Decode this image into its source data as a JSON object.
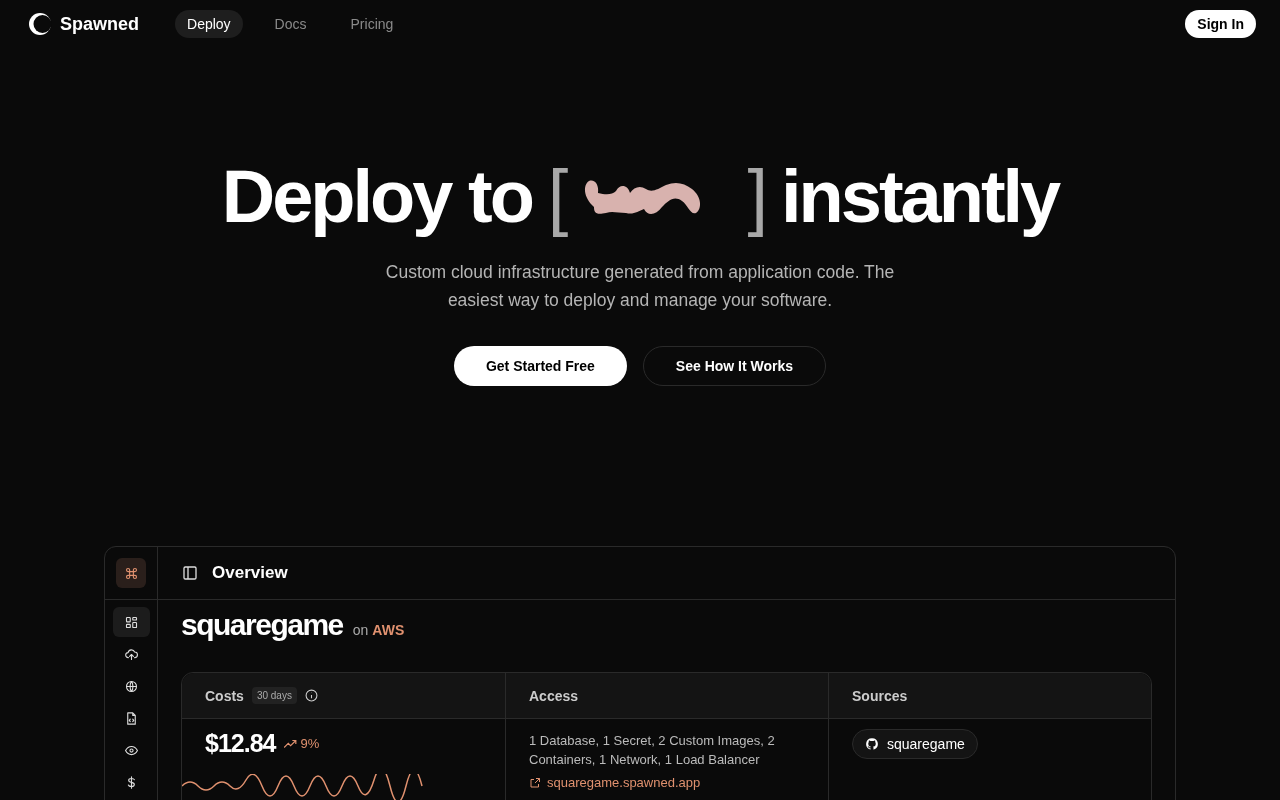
{
  "nav": {
    "brand": "Spawned",
    "links": [
      {
        "label": "Deploy",
        "selected": true
      },
      {
        "label": "Docs",
        "selected": false
      },
      {
        "label": "Pricing",
        "selected": false
      }
    ],
    "sign_in": "Sign In"
  },
  "hero": {
    "title_before": "Deploy to",
    "bracket_open": "[",
    "bracket_close": "]",
    "title_after": "instantly",
    "subtitle": "Custom cloud infrastructure generated from application code. The easiest way to deploy and manage your software.",
    "buttons": [
      {
        "label": "Get Started Free",
        "kind": "primary"
      },
      {
        "label": "See How It Works",
        "kind": "outline"
      }
    ]
  },
  "dashboard": {
    "rail": [
      {
        "selected": true
      },
      {
        "selected": false
      },
      {
        "selected": false
      },
      {
        "selected": false
      },
      {
        "selected": false
      },
      {
        "selected": false
      }
    ],
    "header": "Overview",
    "project": "squaregame",
    "on": "on",
    "provider": "AWS",
    "columns": [
      {
        "title": "Costs",
        "badge": "30 days"
      },
      {
        "title": "Access"
      },
      {
        "title": "Sources"
      }
    ],
    "cost": "$12.84",
    "change": "9%",
    "resources": "1 Database, 1 Secret, 2 Custom Images, 2 Containers, 1 Network, 1 Load Balancer",
    "link": "squaregame.spawned.app",
    "source": "squaregame"
  }
}
